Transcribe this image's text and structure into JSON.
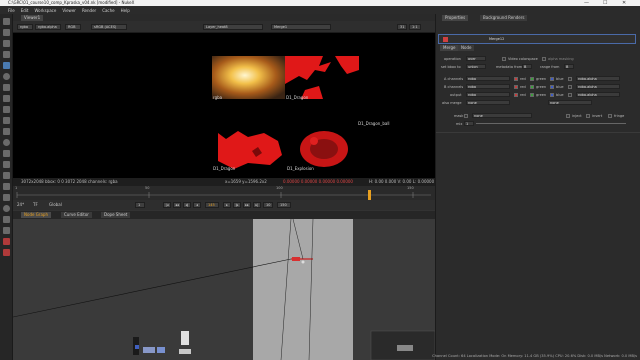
{
  "window": {
    "title": "C:\\GRC\\01_course10_comp_Kpraska_v04.nk [modified] - NukeX",
    "minimize": "—",
    "maximize": "☐",
    "close": "✕"
  },
  "menu": [
    "File",
    "Edit",
    "Workspace",
    "Viewer",
    "Render",
    "Cache",
    "Help"
  ],
  "viewer": {
    "tab_label": "Viewer1",
    "channels": "rgba",
    "layer": "rgba.alpha",
    "colorspace": "RGB",
    "proxy": "sRGB (ACES)",
    "input_a": "Layer_heat8",
    "input_b": "Merge1",
    "zoom": "31",
    "frame_fmt": "1:1",
    "gain_label": "f/8",
    "gain_value": "1",
    "y_label": "Y",
    "y_value": "1",
    "tiles": [
      {
        "label": "rgba",
        "color": "#f2c04a"
      },
      {
        "label": "D1_Dragon",
        "color": "#e01818"
      },
      {
        "label": "D1_Dragon_ball",
        "color": "#e01818"
      },
      {
        "label": "D1_Dragon",
        "color": "#e01818"
      },
      {
        "label": "D1_Explosion",
        "color": "#d81818"
      }
    ],
    "info_left": "3072x2048  bbox: 0 0 3072 2048 channels: rgba",
    "info_mid": "x=1659 y=1596.2x2",
    "info_vals": "0.00000  0.00000  0.00000  0.00000",
    "info_right": "H: 0.00 0.000  V: 0.00 L: 0.00000"
  },
  "timeline": {
    "fps": "24*",
    "tc": "TF",
    "global": "Global",
    "ticks": [
      "1",
      "50",
      "100",
      "150"
    ],
    "start_frame": "1",
    "end_frame": "150",
    "current_frame": "145",
    "step": "10"
  },
  "nodegraph": {
    "tabs": [
      "Node Graph",
      "Curve Editor",
      "Dope Sheet"
    ]
  },
  "properties": {
    "panel_tabs": [
      "Properties",
      "Background Renders"
    ],
    "node_name": "Merge12",
    "node_tabs": [
      "Merge",
      "Node"
    ],
    "operation_label": "operation",
    "operation_value": "over",
    "video_colorspace": "Video colorspace",
    "alpha_masking": "alpha masking",
    "set_bbox_label": "set bbox to",
    "set_bbox_value": "union",
    "metadata_label": "metadata from",
    "metadata_value": "B",
    "range_label": "range from",
    "range_value": "B",
    "a_channels_label": "A channels",
    "a_channels_value": "rgba",
    "b_channels_label": "B channels",
    "b_channels_value": "rgba",
    "output_label": "output",
    "output_value": "rgba",
    "also_merge_label": "also merge",
    "also_merge_value": "none",
    "also_merge_value2": "none",
    "ch_red": "red",
    "ch_green": "green",
    "ch_blue": "blue",
    "ch_alpha": "rgba.alpha",
    "mask_label": "mask",
    "mask_value": "none",
    "inject": "inject",
    "invert": "invert",
    "fringe": "fringe",
    "mix_label": "mix",
    "mix_value": "1"
  },
  "status": {
    "text": "Channel Count: 64  Localization Mode: On  Memory: 11.4 GB (35.9%)  CPU: 20.6%  Disk: 0.0 MB/s  Network: 0.0 MB/s"
  }
}
